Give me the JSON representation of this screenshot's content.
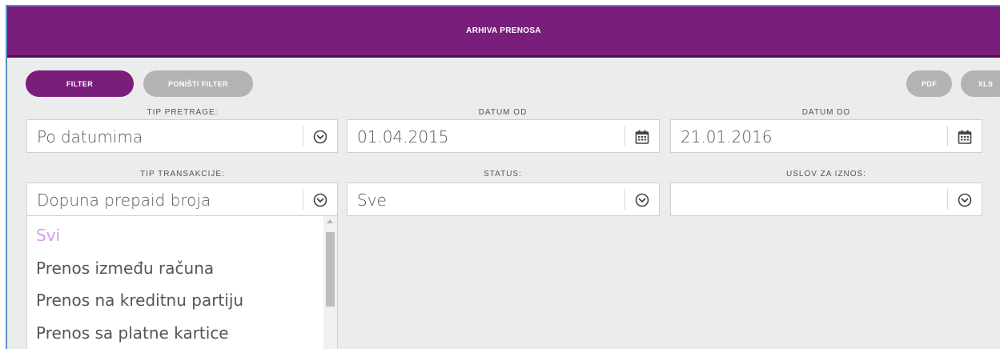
{
  "header": {
    "title": "ARHIVA PRENOSA"
  },
  "toolbar": {
    "filter_label": "FILTER",
    "reset_filter_label": "PONIŠTI FILTER",
    "pdf_label": "PDF",
    "xls_label": "XLS"
  },
  "filters": {
    "search_type": {
      "label": "TIP PRETRAGE:",
      "value": "Po datumima",
      "icon": "chevron-down-circle-icon"
    },
    "date_from": {
      "label": "DATUM OD",
      "value": "01.04.2015",
      "icon": "calendar-icon"
    },
    "date_to": {
      "label": "DATUM DO",
      "value": "21.01.2016",
      "icon": "calendar-icon"
    },
    "transaction_type": {
      "label": "TIP TRANSAKCIJE:",
      "value": "Dopuna prepaid broja",
      "icon": "chevron-down-circle-icon",
      "options": [
        "Svi",
        "Prenos između računa",
        "Prenos na kreditnu partiju",
        "Prenos sa platne kartice"
      ],
      "highlighted_option": "Svi"
    },
    "status": {
      "label": "STATUS:",
      "value": "Sve",
      "icon": "chevron-down-circle-icon"
    },
    "amount_condition": {
      "label": "USLOV ZA IZNOS:",
      "value": "",
      "icon": "chevron-down-circle-icon"
    }
  },
  "colors": {
    "brand_purple": "#7a1e7c",
    "button_grey": "#b3b3b3",
    "highlight_option": "#d89ee8",
    "background": "#ececec"
  }
}
